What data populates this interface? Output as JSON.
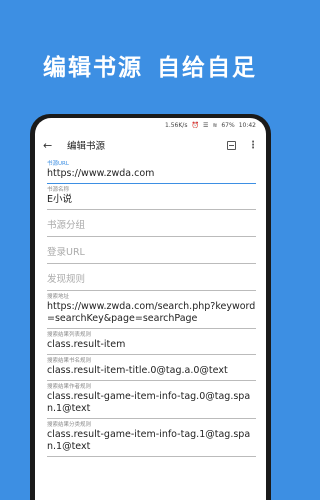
{
  "promo": {
    "left": "编辑书源",
    "right": "自给自足"
  },
  "status": {
    "speed": "1.56K/s",
    "alarm": "⏰",
    "signal": "☰",
    "wifi": "≋",
    "battery": "67%",
    "time": "10:42"
  },
  "appbar": {
    "back": "←",
    "title": "编辑书源",
    "more": "⋮"
  },
  "fields": [
    {
      "label": "书源URL",
      "value": "https://www.zwda.com"
    },
    {
      "label": "书源名称",
      "value": "E小说"
    },
    {
      "placeholder": "书源分组"
    },
    {
      "placeholder": "登录URL"
    },
    {
      "placeholder": "发现规则"
    },
    {
      "label": "搜索地址",
      "value": "https://www.zwda.com/search.php?keyword=searchKey&page=searchPage"
    },
    {
      "label": "搜索结果列表规则",
      "value": "class.result-item"
    },
    {
      "label": "搜索结果书名规则",
      "value": "class.result-item-title.0@tag.a.0@text"
    },
    {
      "label": "搜索结果作者规则",
      "value": "class.result-game-item-info-tag.0@tag.span.1@text"
    },
    {
      "label": "搜索结果分类规则",
      "value": "class.result-game-item-info-tag.1@tag.span.1@text"
    }
  ],
  "colors": {
    "background": "#3d8fe3",
    "accent": "#3d8fe3"
  }
}
